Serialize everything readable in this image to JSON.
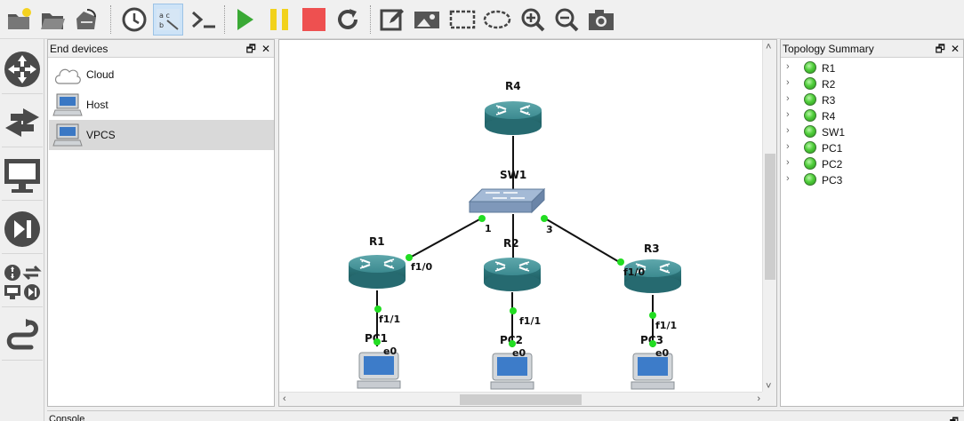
{
  "toolbar": {
    "items": [
      {
        "name": "new-project-icon"
      },
      {
        "name": "open-project-icon"
      },
      {
        "name": "snapshot-icon"
      },
      {
        "name": "clock-icon"
      },
      {
        "name": "show-interface-labels-icon"
      },
      {
        "name": "console-icon"
      },
      {
        "name": "start-icon"
      },
      {
        "name": "pause-icon"
      },
      {
        "name": "stop-icon"
      },
      {
        "name": "reload-icon"
      },
      {
        "name": "add-note-icon"
      },
      {
        "name": "insert-image-icon"
      },
      {
        "name": "draw-rectangle-icon"
      },
      {
        "name": "draw-ellipse-icon"
      },
      {
        "name": "zoom-in-icon"
      },
      {
        "name": "zoom-out-icon"
      },
      {
        "name": "screenshot-icon"
      }
    ]
  },
  "leftbar": {
    "items": [
      {
        "name": "browse-routers-icon"
      },
      {
        "name": "browse-switches-icon"
      },
      {
        "name": "browse-end-devices-icon"
      },
      {
        "name": "browse-security-devices-icon"
      },
      {
        "name": "browse-all-devices-icon"
      },
      {
        "name": "add-link-icon"
      }
    ]
  },
  "devices_panel": {
    "title": "End devices",
    "items": [
      {
        "label": "Cloud",
        "icon": "cloud-icon"
      },
      {
        "label": "Host",
        "icon": "host-icon"
      },
      {
        "label": "VPCS",
        "icon": "vpcs-icon",
        "selected": true
      }
    ]
  },
  "topology_panel": {
    "title": "Topology Summary",
    "items": [
      "R1",
      "R2",
      "R3",
      "R4",
      "SW1",
      "PC1",
      "PC2",
      "PC3"
    ],
    "status_color": "#3fbf2f"
  },
  "topology": {
    "nodes": {
      "R4": "R4",
      "SW1": "SW1",
      "R1": "R1",
      "R2": "R2",
      "R3": "R3",
      "PC1": "PC1",
      "PC2": "PC2",
      "PC3": "PC3"
    },
    "ports": {
      "sw_1": "1",
      "sw_3": "3",
      "r1_f10": "f1/0",
      "r3_f10": "f1/0",
      "r1_f11": "f1/1",
      "r2_f11": "f1/1",
      "r3_f11": "f1/1",
      "pc1_e0": "e0",
      "pc2_e0": "e0",
      "pc3_e0": "e0"
    },
    "link_dot_color": "#22dd22"
  },
  "console": {
    "title": "Console"
  },
  "colors": {
    "router": "#3f8d92",
    "switch": "#8aa6c8"
  }
}
